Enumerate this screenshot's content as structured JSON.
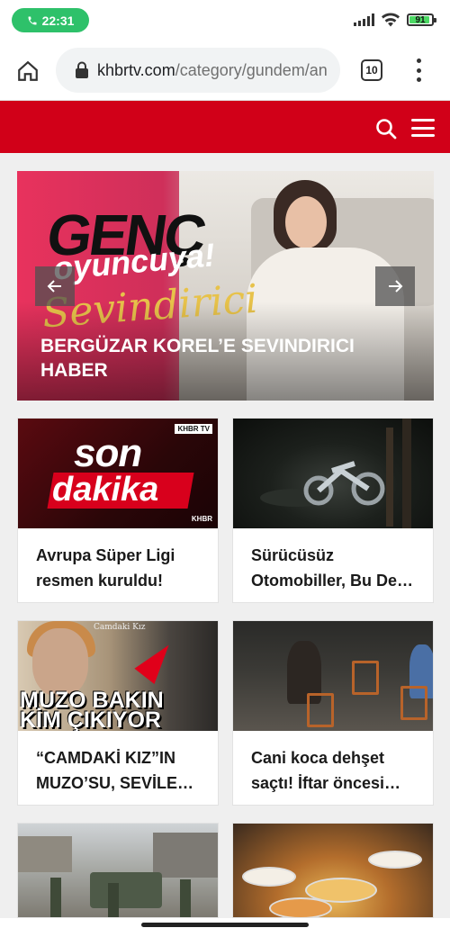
{
  "status_bar": {
    "time": "22:31",
    "battery": "91",
    "battery_level": 0.91
  },
  "browser": {
    "url_host": "khbrtv.com",
    "url_path": "/category/gundem/an",
    "tab_count": "10"
  },
  "hero": {
    "title": "BERGÜZAR KOREL’E SEVINDIRICI HABER",
    "image_words": [
      "GENÇ",
      "oyuncuya!",
      "Sevindirici"
    ]
  },
  "cards": [
    {
      "title": "Avrupa Süper Ligi resmen kuruldu!",
      "line1": "Avrupa Süper Ligi",
      "line2": "resmen kuruldu!",
      "image_words": [
        "son",
        "dakika",
        "KHBR TV",
        "KHBR"
      ]
    },
    {
      "title": "Sürücüsüz Otomobiller, Bu Def…",
      "line1": "Sürücüsüz",
      "line2": "Otomobiller, Bu Def…"
    },
    {
      "title": "“CAMDAKİ KIZ”IN MUZO’SU, SEVİLEN…",
      "line1": "“CAMDAKİ KIZ”IN",
      "line2": "MUZO’SU, SEVİLEN…",
      "image_words": [
        "MUZO BAKIN",
        "KİM ÇIKIYOR",
        "Camdaki Kız"
      ]
    },
    {
      "title": "Cani koca dehşet saçtı! İftar öncesi…",
      "line1": "Cani koca dehşet",
      "line2": "saçtı! İftar öncesi…"
    },
    {
      "title": "",
      "line1": "",
      "line2": ""
    },
    {
      "title": "",
      "line1": "",
      "line2": ""
    }
  ],
  "colors": {
    "brand_red": "#d10018",
    "call_green": "#2ec16a"
  },
  "icons": [
    "phone-icon",
    "signal-icon",
    "wifi-icon",
    "battery-icon",
    "home-icon",
    "lock-icon",
    "tabs-icon",
    "more-vert-icon",
    "search-icon",
    "menu-icon",
    "arrow-left-icon",
    "arrow-right-icon"
  ]
}
